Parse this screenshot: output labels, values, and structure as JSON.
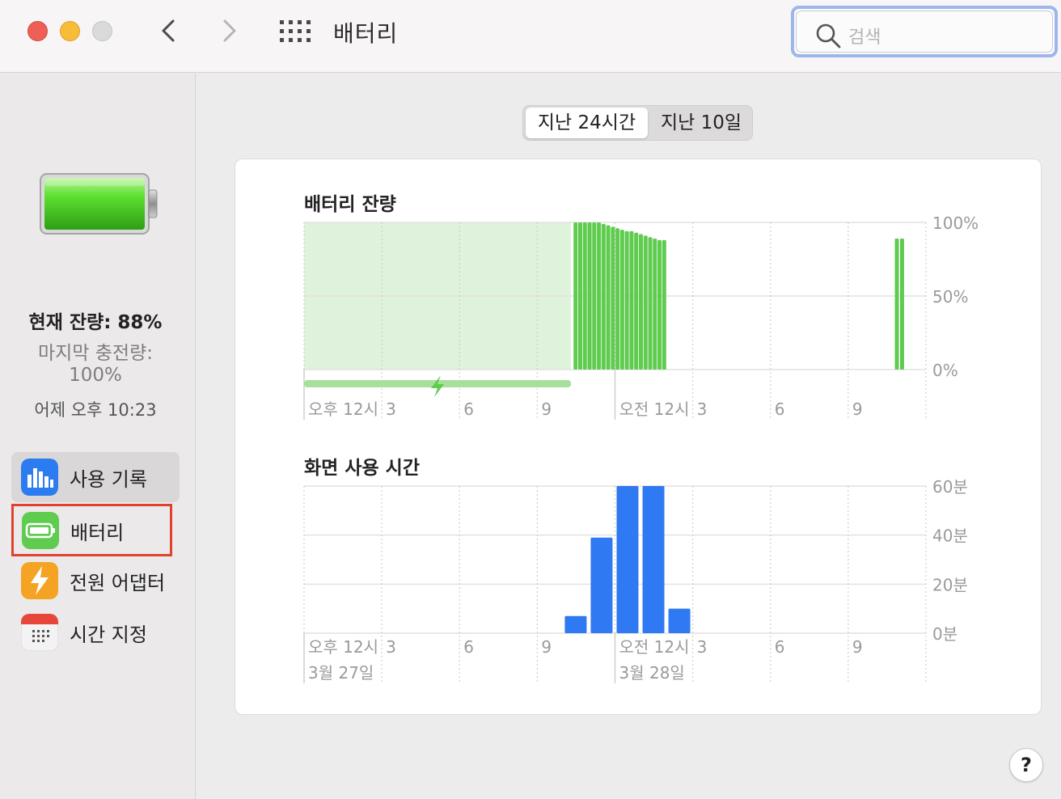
{
  "window": {
    "title": "배터리",
    "search_placeholder": "검색"
  },
  "sidebar": {
    "current_level": "현재 잔량: 88%",
    "last_charge_label": "마지막 충전량:",
    "last_charge_value": "100%",
    "last_charge_time": "어제 오후 10:23",
    "items": [
      {
        "label": "사용 기록",
        "icon": "usage-history-icon",
        "selected": true
      },
      {
        "label": "배터리",
        "icon": "battery-icon",
        "selected": false
      },
      {
        "label": "전원 어댑터",
        "icon": "power-adapter-icon",
        "selected": false
      },
      {
        "label": "시간 지정",
        "icon": "schedule-calendar-icon",
        "selected": false
      }
    ]
  },
  "segment": {
    "options": [
      "지난 24시간",
      "지난 10일"
    ],
    "selected": "지난 24시간"
  },
  "colors": {
    "battery_green": "#5fcb4f",
    "charging_fill": "#dff2dc",
    "screen_blue": "#2f79f2",
    "highlight_red": "#e0422f"
  },
  "chart_data": [
    {
      "type": "bar",
      "title": "배터리 잔량",
      "y_ticks": [
        "100%",
        "50%",
        "0%"
      ],
      "ylim": [
        0,
        100
      ],
      "x_ticks": [
        "오후 12시",
        "3",
        "6",
        "9",
        "오전 12시",
        "3",
        "6",
        "9"
      ],
      "charging_period_hours": [
        0,
        10.3
      ],
      "series": [
        {
          "hours": [
            10.4,
            10.58,
            10.76,
            10.94,
            11.12,
            11.3,
            11.48,
            11.66,
            11.84,
            12.02,
            12.2,
            12.38,
            12.56,
            12.74,
            12.92,
            13.1,
            13.28,
            13.46,
            13.64,
            13.82,
            22.8,
            23.0
          ],
          "values": [
            100,
            100,
            100,
            100,
            100,
            100,
            99,
            98,
            97,
            96,
            95,
            94,
            94,
            93,
            92,
            91,
            90,
            89,
            88,
            88,
            89,
            89
          ]
        }
      ]
    },
    {
      "type": "bar",
      "title": "화면 사용 시간",
      "y_ticks": [
        "60분",
        "40분",
        "20분",
        "0분"
      ],
      "ylim": [
        0,
        60
      ],
      "x_ticks": [
        "오후 12시",
        "3",
        "6",
        "9",
        "오전 12시",
        "3",
        "6",
        "9"
      ],
      "x_dates": [
        "3월 27일",
        "3월 28일"
      ],
      "series": [
        {
          "hours": [
            10,
            11,
            12,
            13,
            14
          ],
          "values": [
            7,
            39,
            60,
            60,
            10
          ]
        }
      ]
    }
  ]
}
